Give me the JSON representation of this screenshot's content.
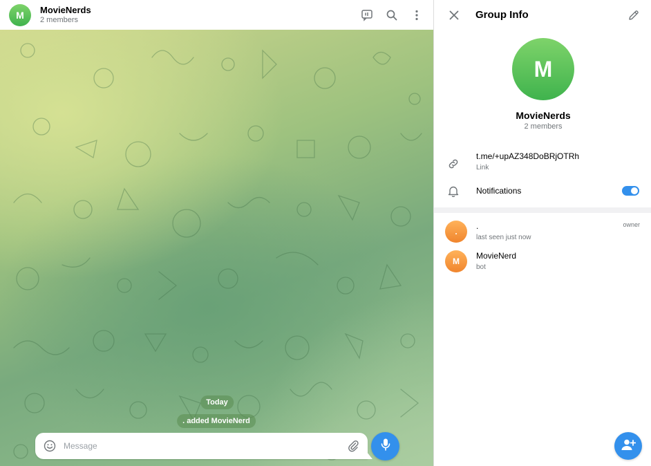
{
  "chat": {
    "avatar_letter": "M",
    "title": "MovieNerds",
    "subtitle": "2 members",
    "header_icons": [
      "video-chat-icon",
      "search-icon",
      "more-vertical-icon"
    ],
    "date_pill": "Today",
    "service_message": ". added MovieNerd",
    "composer": {
      "placeholder": "Message",
      "left_icon": "emoji-icon",
      "right_icon": "attach-icon",
      "send_icon": "microphone-icon"
    }
  },
  "info": {
    "title": "Group Info",
    "close_icon": "close-icon",
    "edit_icon": "pencil-icon",
    "avatar_letter": "M",
    "group_name": "MovieNerds",
    "group_count": "2 members",
    "link": {
      "value": "t.me/+upAZ348DoBRjOTRh",
      "label": "Link",
      "icon": "link-icon"
    },
    "notifications": {
      "label": "Notifications",
      "icon": "bell-icon",
      "enabled": true
    },
    "members": [
      {
        "avatar": ".",
        "name": ".",
        "status": "last seen just now",
        "role": "owner"
      },
      {
        "avatar": "M",
        "name": "MovieNerd",
        "status": "bot",
        "role": ""
      }
    ],
    "add_member_icon": "add-user-icon"
  },
  "colors": {
    "accent": "#3390ec",
    "group_avatar": "#4fbf55",
    "member_avatar": "#f39a3f",
    "secondary_text": "#707579"
  }
}
